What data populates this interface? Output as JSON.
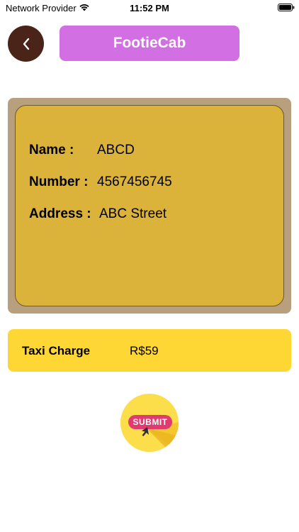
{
  "status_bar": {
    "carrier": "Network Provider",
    "time": "11:52 PM"
  },
  "header": {
    "back_icon": "chevron-left-icon",
    "title": "FootieCab"
  },
  "details": {
    "name_label": "Name :",
    "name_value": "ABCD",
    "number_label": "Number :",
    "number_value": "4567456745",
    "address_label": "Address :",
    "address_value": "ABC Street"
  },
  "charge": {
    "label": "Taxi Charge",
    "value": "R$59"
  },
  "submit": {
    "label": "SUBMIT"
  },
  "colors": {
    "back_button": "#4a2419",
    "title_pill": "#d26fe3",
    "info_frame": "#b89f7e",
    "info_card": "#dbb33b",
    "charge_bar": "#fed734",
    "submit_circle": "#fcdd4a",
    "submit_badge": "#e23a6e"
  }
}
